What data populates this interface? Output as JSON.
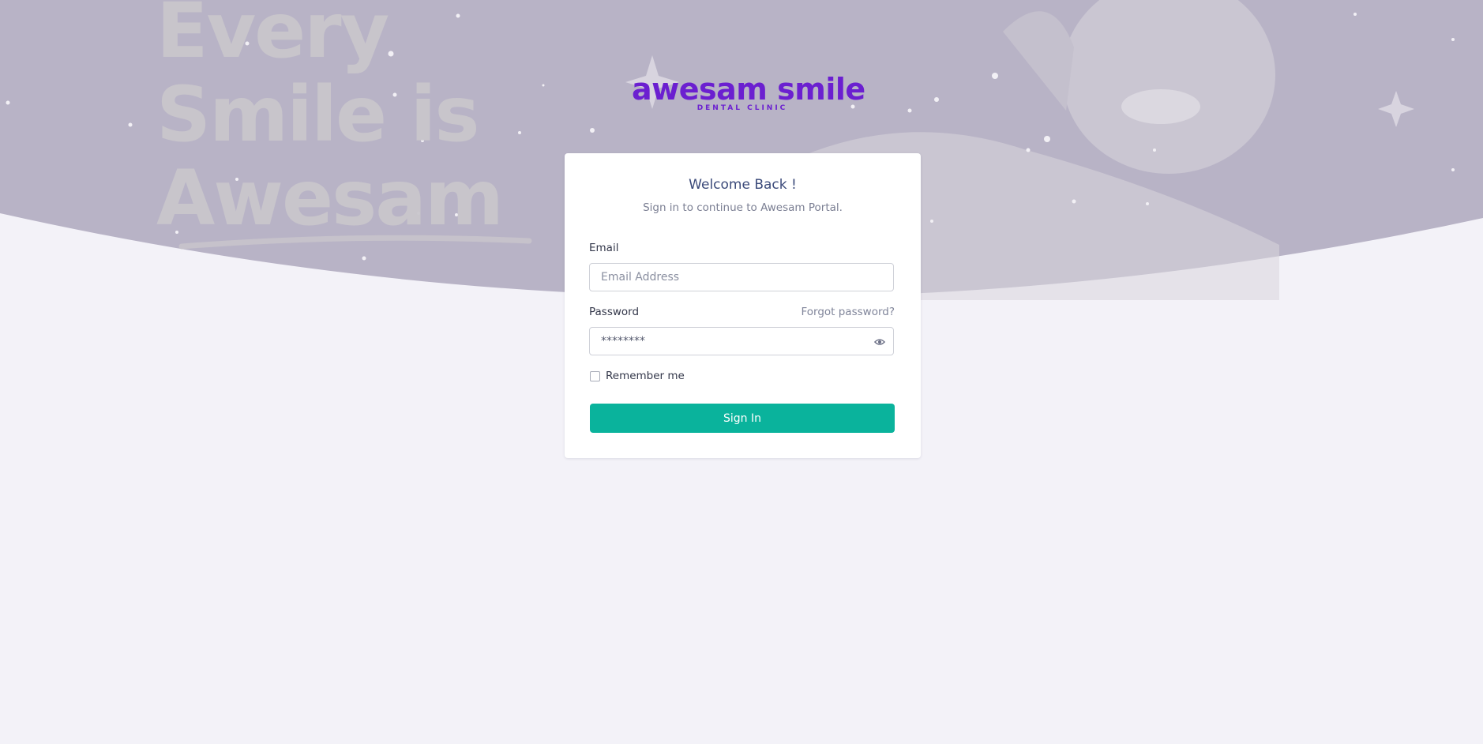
{
  "hero": {
    "tagline_lines": [
      "Every",
      "Smile is",
      "Awesam"
    ]
  },
  "logo": {
    "wordmark": "awesam smile",
    "subtitle": "DENTAL CLINIC"
  },
  "login": {
    "title": "Welcome Back !",
    "subtitle": "Sign in to continue to Awesam Portal.",
    "email": {
      "label": "Email",
      "placeholder": "Email Address",
      "value": ""
    },
    "password": {
      "label": "Password",
      "value": "********",
      "forgot_link": "Forgot password?"
    },
    "remember_me": {
      "label": "Remember me",
      "checked": false
    },
    "submit_label": "Sign In"
  },
  "colors": {
    "page_bg": "#f3f2f8",
    "hero_bg": "#b8b3c6",
    "brand_purple": "#6b1fd0",
    "primary_button": "#0ab39c",
    "title_text": "#3b4a7a"
  },
  "icons": {
    "password_toggle": "eye-icon"
  }
}
